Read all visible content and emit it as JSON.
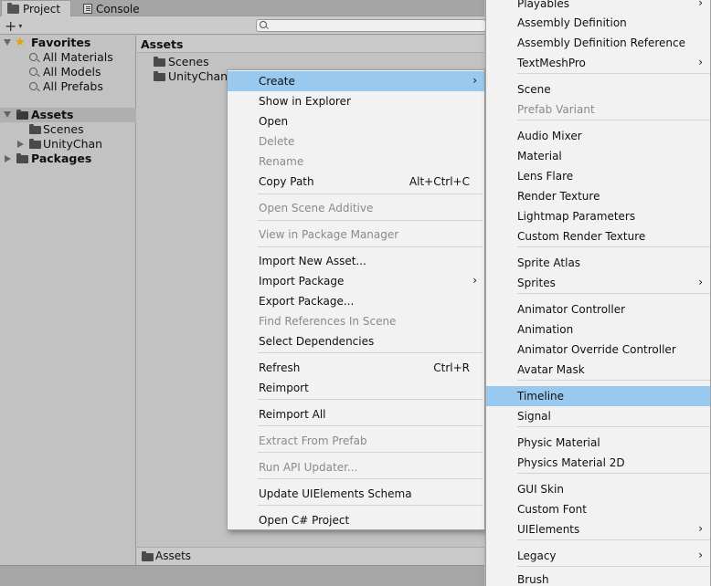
{
  "tabs": {
    "project": "Project",
    "console": "Console"
  },
  "toolbar": {
    "add_icon": "+",
    "add_caret": "▾"
  },
  "tree": {
    "favorites": "Favorites",
    "fav_items": [
      "All Materials",
      "All Models",
      "All Prefabs"
    ],
    "assets": "Assets",
    "asset_children": [
      "Scenes",
      "UnityChan"
    ],
    "packages": "Packages"
  },
  "assets_pane": {
    "header": "Assets",
    "items": [
      "Scenes",
      "UnityChan"
    ],
    "footer": "Assets"
  },
  "context_menu": {
    "items": [
      {
        "label": "Create",
        "highlighted": true,
        "submenu": true
      },
      {
        "label": "Show in Explorer"
      },
      {
        "label": "Open"
      },
      {
        "label": "Delete",
        "disabled": true
      },
      {
        "label": "Rename",
        "disabled": true
      },
      {
        "label": "Copy Path",
        "shortcut": "Alt+Ctrl+C"
      },
      {
        "label": "Open Scene Additive",
        "disabled": true
      },
      {
        "label": "View in Package Manager",
        "disabled": true
      },
      {
        "label": "Import New Asset..."
      },
      {
        "label": "Import Package",
        "submenu": true
      },
      {
        "label": "Export Package..."
      },
      {
        "label": "Find References In Scene",
        "disabled": true
      },
      {
        "label": "Select Dependencies"
      },
      {
        "label": "Refresh",
        "shortcut": "Ctrl+R"
      },
      {
        "label": "Reimport"
      },
      {
        "label": "Reimport All"
      },
      {
        "label": "Extract From Prefab",
        "disabled": true
      },
      {
        "label": "Run API Updater...",
        "disabled": true
      },
      {
        "label": "Update UIElements Schema"
      },
      {
        "label": "Open C# Project"
      }
    ]
  },
  "create_submenu": {
    "items": [
      {
        "label": "Playables",
        "submenu": true
      },
      {
        "label": "Assembly Definition"
      },
      {
        "label": "Assembly Definition Reference"
      },
      {
        "label": "TextMeshPro",
        "submenu": true
      },
      {
        "label": "Scene"
      },
      {
        "label": "Prefab Variant",
        "disabled": true
      },
      {
        "label": "Audio Mixer"
      },
      {
        "label": "Material"
      },
      {
        "label": "Lens Flare"
      },
      {
        "label": "Render Texture"
      },
      {
        "label": "Lightmap Parameters"
      },
      {
        "label": "Custom Render Texture"
      },
      {
        "label": "Sprite Atlas"
      },
      {
        "label": "Sprites",
        "submenu": true
      },
      {
        "label": "Animator Controller"
      },
      {
        "label": "Animation"
      },
      {
        "label": "Animator Override Controller"
      },
      {
        "label": "Avatar Mask"
      },
      {
        "label": "Timeline",
        "highlighted": true
      },
      {
        "label": "Signal"
      },
      {
        "label": "Physic Material"
      },
      {
        "label": "Physics Material 2D"
      },
      {
        "label": "GUI Skin"
      },
      {
        "label": "Custom Font"
      },
      {
        "label": "UIElements",
        "submenu": true
      },
      {
        "label": "Legacy",
        "submenu": true
      },
      {
        "label": "Brush"
      }
    ]
  },
  "arrow_glyph": "›",
  "colors": {
    "highlight": "#99c9ef",
    "menu_bg": "#f2f2f2",
    "panel_bg": "#c2c2c2",
    "star": "#e4a400"
  }
}
